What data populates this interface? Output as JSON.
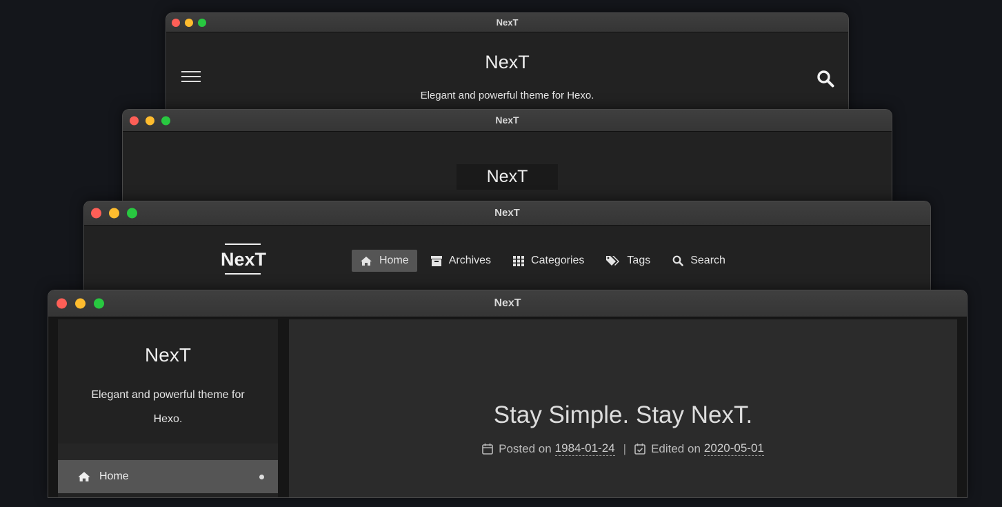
{
  "windows": {
    "mobile": {
      "title": "NexT",
      "site_title": "NexT",
      "subtitle": "Elegant and powerful theme for Hexo."
    },
    "muse": {
      "title": "NexT",
      "brand": "NexT"
    },
    "mist": {
      "title": "NexT",
      "logo": "NexT",
      "menu": [
        {
          "label": "Home",
          "icon": "home-icon",
          "active": true
        },
        {
          "label": "Archives",
          "icon": "archive-icon",
          "active": false
        },
        {
          "label": "Categories",
          "icon": "grid-icon",
          "active": false
        },
        {
          "label": "Tags",
          "icon": "tags-icon",
          "active": false
        },
        {
          "label": "Search",
          "icon": "search-icon",
          "active": false
        }
      ]
    },
    "pisces": {
      "title": "NexT",
      "sidebar": {
        "site_title": "NexT",
        "subtitle": "Elegant and powerful theme for Hexo.",
        "home_label": "Home"
      },
      "post": {
        "title": "Stay Simple. Stay NexT.",
        "posted_label": "Posted on",
        "posted_date": "1984-01-24",
        "separator": "|",
        "edited_label": "Edited on",
        "edited_date": "2020-05-01"
      }
    }
  },
  "colors": {
    "background": "#14161b",
    "window_body": "#222222",
    "active_menu": "#555555",
    "traffic_red": "#fe5f57",
    "traffic_yellow": "#febc2e",
    "traffic_green": "#28c840"
  }
}
